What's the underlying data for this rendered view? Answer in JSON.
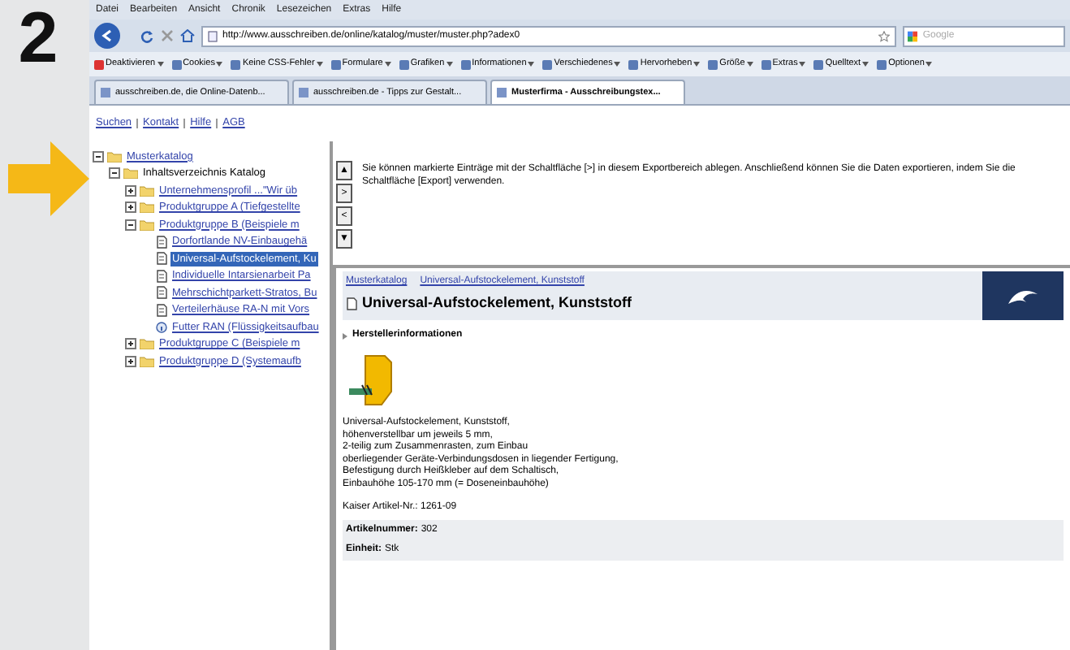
{
  "figure_number": "2",
  "menu": [
    "Datei",
    "Bearbeiten",
    "Ansicht",
    "Chronik",
    "Lesezeichen",
    "Extras",
    "Hilfe"
  ],
  "url": "http://www.ausschreiben.de/online/katalog/muster/muster.php?adex0",
  "search_placeholder": "Google",
  "bookmarks": [
    "Deaktivieren",
    "Cookies",
    "Keine CSS-Fehler",
    "Formulare",
    "Grafiken",
    "Informationen",
    "Verschiedenes",
    "Hervorheben",
    "Größe",
    "Extras",
    "Quelltext",
    "Optionen"
  ],
  "tabs": [
    {
      "label": "ausschreiben.de, die Online-Datenb...",
      "selected": false
    },
    {
      "label": "ausschreiben.de - Tipps zur Gestalt...",
      "selected": false
    },
    {
      "label": "Musterfirma - Ausschreibungstex...",
      "selected": true
    }
  ],
  "top_links": [
    "Suchen",
    "Kontakt",
    "Hilfe",
    "AGB"
  ],
  "tree": [
    {
      "label": "Musterkatalog",
      "kind": "root",
      "expanded": true,
      "selected": false,
      "children": [
        {
          "label": "Inhaltsverzeichnis Katalog",
          "kind": "folder",
          "expanded": true,
          "selected": false,
          "children": [
            {
              "label": "Unternehmensprofil ...\"Wir üb",
              "kind": "folder",
              "expanded": false,
              "selected": false
            },
            {
              "label": "Produktgruppe A (Tiefgestellte",
              "kind": "folder",
              "expanded": false,
              "selected": false
            },
            {
              "label": "Produktgruppe B (Beispiele m",
              "kind": "folder",
              "expanded": true,
              "selected": false,
              "children": [
                {
                  "label": "Dorfortlande NV-Einbaugehä",
                  "kind": "item",
                  "selected": false
                },
                {
                  "label": "Universal-Aufstockelement, Ku",
                  "kind": "item",
                  "selected": true
                },
                {
                  "label": "Individuelle Intarsienarbeit Pa",
                  "kind": "item",
                  "selected": false
                },
                {
                  "label": "Mehrschichtparkett-Stratos, Bu",
                  "kind": "item",
                  "selected": false
                },
                {
                  "label": "Verteilerhäuse RA-N mit Vors",
                  "kind": "item",
                  "selected": false
                },
                {
                  "label": "Futter RAN (Flüssigkeitsaufbau",
                  "kind": "info",
                  "selected": false
                }
              ]
            },
            {
              "label": "Produktgruppe C (Beispiele m",
              "kind": "folder",
              "expanded": false,
              "selected": false
            },
            {
              "label": "Produktgruppe D (Systemaufb",
              "kind": "folder",
              "expanded": false,
              "selected": false
            }
          ]
        }
      ]
    }
  ],
  "export_buttons": [
    "▲",
    ">",
    "<",
    "▼"
  ],
  "export_hint": "Sie können markierte Einträge mit der Schaltfläche [>] in diesem Exportbereich ablegen. Anschließend können Sie die Daten exportieren, indem Sie die Schaltfläche [Export] verwenden.",
  "breadcrumb": [
    "Musterkatalog",
    "Universal-Aufstockelement, Kunststoff"
  ],
  "product_title": "Universal-Aufstockelement, Kunststoff",
  "section": "Herstellerinformationen",
  "description": [
    "Universal-Aufstockelement, Kunststoff,",
    "höhenverstellbar um jeweils 5 mm,",
    "2-teilig zum Zusammenrasten, zum Einbau",
    "oberliegender Geräte-Verbindungsdosen in liegender Fertigung,",
    "Befestigung durch Heißkleber auf dem Schaltisch,",
    "Einbauhöhe 105-170 mm (= Doseneinbauhöhe)"
  ],
  "article_no": "Kaiser Artikel-Nr.: 1261-09",
  "fields": [
    {
      "label": "Artikelnummer:",
      "value": "302"
    },
    {
      "label": "Einheit:",
      "value": "Stk"
    }
  ]
}
